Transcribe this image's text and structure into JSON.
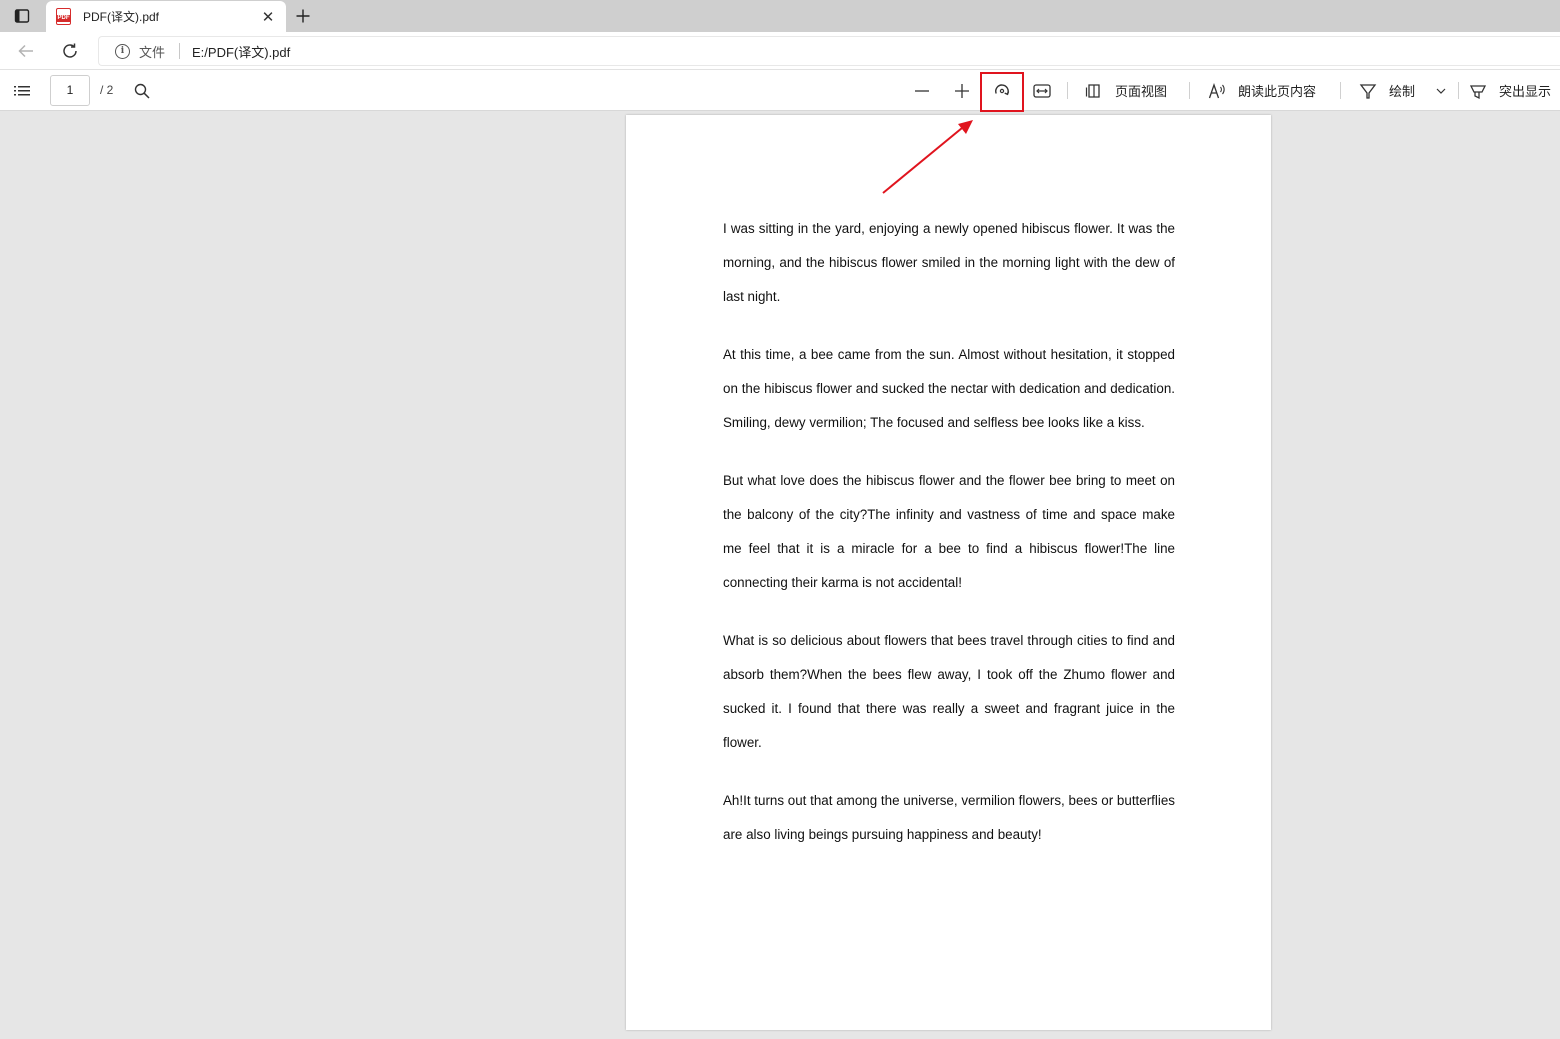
{
  "tab": {
    "title": "PDF(译文).pdf",
    "badge": "PDF",
    "close": "✕"
  },
  "address": {
    "site_label": "文件",
    "url": "E:/PDF(译文).pdf"
  },
  "pdf_toolbar": {
    "page_current": "1",
    "page_total": "/ 2",
    "page_view_label": "页面视图",
    "read_aloud_label": "朗读此页内容",
    "draw_label": "绘制",
    "highlight_label": "突出显示"
  },
  "annotation": {
    "color": "#e0141e"
  },
  "document": {
    "paragraphs": [
      "I was sitting in the yard, enjoying a newly opened hibiscus flower. It was the morning, and the hibiscus flower smiled in the morning light with the dew of last night.",
      "At this time, a bee came from the sun. Almost without hesitation, it stopped on the hibiscus flower and sucked the nectar with dedication and dedication. Smiling, dewy vermilion; The focused and selfless bee looks like a kiss.",
      "But what love does the hibiscus flower and the flower bee bring to meet on the balcony of the city?The infinity and vastness of time and space make me feel that it is a miracle for a bee to find a hibiscus flower!The line connecting their karma is not accidental!",
      "What is so delicious about flowers that bees travel through cities to find and absorb them?When the bees flew away, I took off the Zhumo flower and sucked it. I found that there was really a sweet and fragrant juice in the flower.",
      "Ah!It turns out that among the universe, vermilion flowers, bees or butterflies are also living beings pursuing happiness and beauty!"
    ]
  }
}
